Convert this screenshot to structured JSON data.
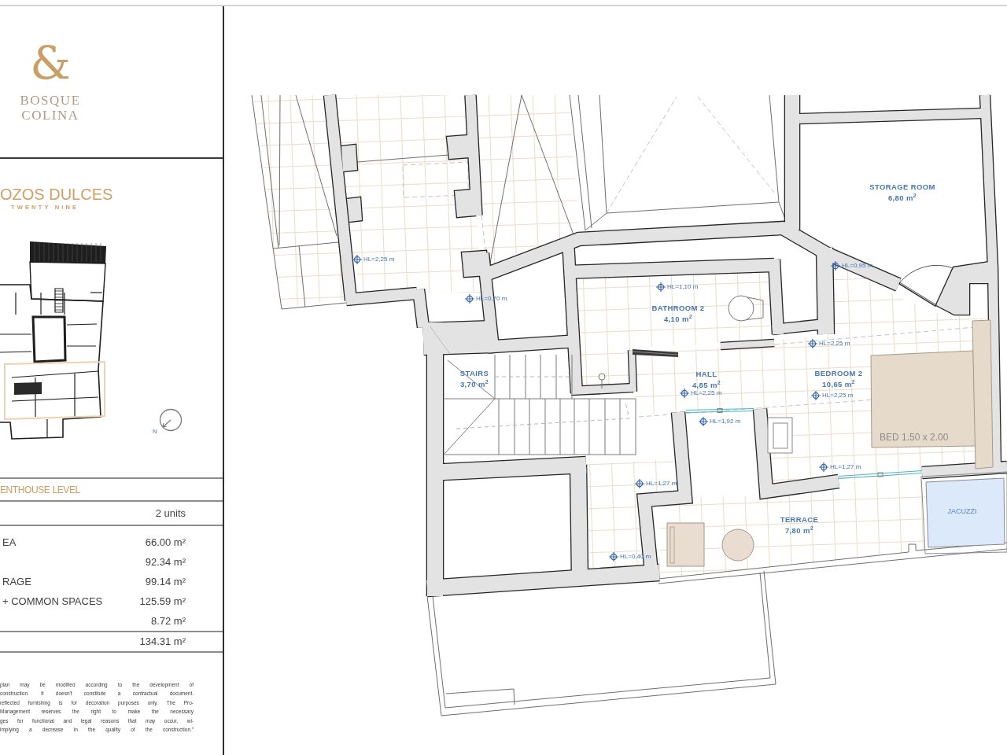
{
  "brand": {
    "monogram": "&",
    "name_lines": [
      "BOSQUE",
      "COLINA"
    ]
  },
  "project": {
    "name": "OZOS DULCES",
    "tagline": "TWENTY NINE",
    "compass_label": "N"
  },
  "level": {
    "title": "ENTHOUSE LEVEL",
    "units": "2 units"
  },
  "areas": [
    {
      "label": "EA",
      "value": "66.00 m²"
    },
    {
      "value": "92.34 m²"
    },
    {
      "label": "RAGE",
      "value": "99.14 m²"
    },
    {
      "label": "+ COMMON SPACES",
      "value": "125.59 m²"
    },
    {
      "value": "8.72 m²"
    }
  ],
  "total": {
    "value": "134.31 m²"
  },
  "disclaimer": {
    "lines": [
      "plan may be modified according to the development of",
      "construction. It doesn't constitute a contractual document.",
      "reflected furnishing is for decoration purposes only. The Pro-",
      "Management reserves the right to make the necessary",
      "ges for functional and legal reasons that may occur, wi-",
      "implying a decrease in the quality of the construction.”"
    ]
  },
  "plan": {
    "rooms": [
      {
        "name": "STORAGE ROOM",
        "area": "6,80 m$^{2}$"
      },
      {
        "name": "BATHROOM 2",
        "area": "4,10 m$^{2}$"
      },
      {
        "name": "STAIRS",
        "area": "3,70 m$^{2}$"
      },
      {
        "name": "HALL",
        "area": "4,85 m$^{2}$"
      },
      {
        "name": "BEDROOM 2",
        "area": "10,65 m$^{2}$"
      },
      {
        "name": "TERRACE",
        "area": "7,80 m$^{2}$"
      }
    ],
    "height_marks": [
      {
        "text": "HL=2,25 m"
      },
      {
        "text": "HL=0,95 m"
      },
      {
        "text": "HL=1,10 m"
      },
      {
        "text": "HL=0,70 m"
      },
      {
        "text": "HL=2,25 m"
      },
      {
        "text": "HL=2,25 m"
      },
      {
        "text": "HL=2,25 m"
      },
      {
        "text": "HL=1,92 m"
      },
      {
        "text": "HL=1,27 m"
      },
      {
        "text": "HL=1,27 m"
      },
      {
        "text": "HL=0,40 m"
      }
    ],
    "furniture": [
      {
        "kind": "bed",
        "label": "BED 1.50 x 2.00"
      },
      {
        "kind": "jacuzzi",
        "label": "JACUZZI"
      }
    ]
  }
}
